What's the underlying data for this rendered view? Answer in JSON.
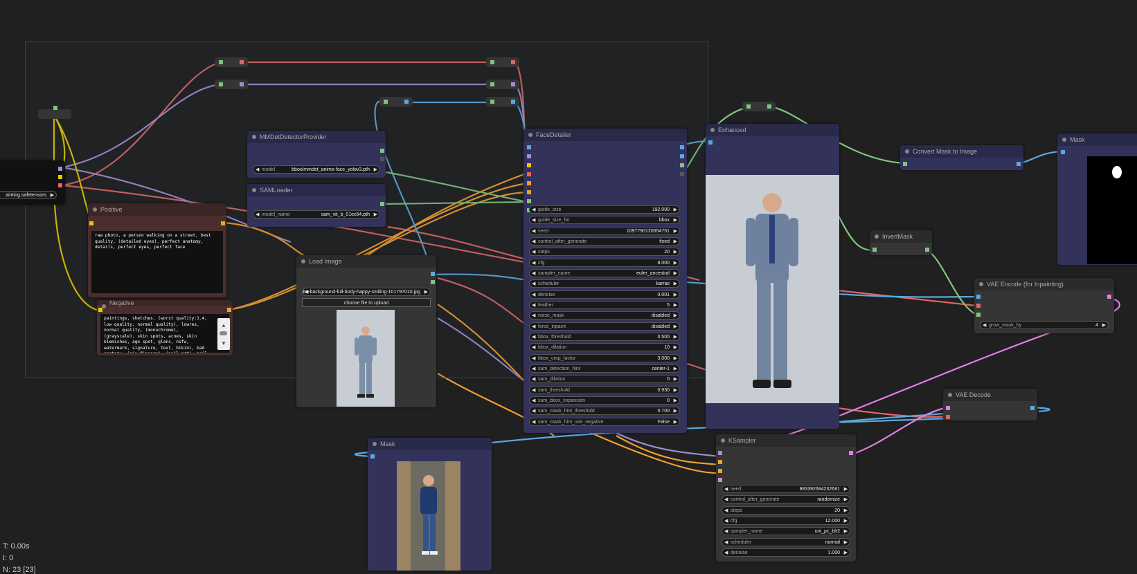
{
  "nodes": {
    "mmdet": {
      "title": "MMDetDetectorProvider",
      "model_label": "model",
      "model_value": "bbox/mmdet_anime-face_yolov3.pth"
    },
    "sam": {
      "title": "SAMLoader",
      "model_label": "model_name",
      "model_value": "sam_vit_b_01ec64.pth"
    },
    "checkpoint": {
      "value": "ainting.safetensors"
    },
    "positive": {
      "title": "Positive",
      "text": "raw photo, a person walking on a street, best quality, (detailed eyes), perfect anatomy, details, perfect eyes, perfect face"
    },
    "negative": {
      "title": "Negative",
      "text": "paintings, sketches, (worst quality:1.4, low quality, normal quality), lowres, normal quality, (monochrome), (grayscale), skin spots, acnes, skin blemishes, age spot, glans, nsfw, watermark, signature, text, bikini, bad anatomy, (six_fingers), (nail_art), nail"
    },
    "load_image": {
      "title": "Load Image",
      "image_value": "business-man-isolated-white-background-full-body-happy-smiling-101797010.jpg",
      "upload_label": "choose file to upload"
    },
    "facedetailer": {
      "title": "FaceDetailer",
      "widgets": [
        {
          "label": "guide_size",
          "value": "192.000"
        },
        {
          "label": "guide_size_for",
          "value": "bbox"
        },
        {
          "label": "seed",
          "value": "1097790120654751"
        },
        {
          "label": "control_after_generate",
          "value": "fixed"
        },
        {
          "label": "steps",
          "value": "20"
        },
        {
          "label": "cfg",
          "value": "8.000"
        },
        {
          "label": "sampler_name",
          "value": "euler_ancestral"
        },
        {
          "label": "scheduler",
          "value": "karras"
        },
        {
          "label": "denoise",
          "value": "0.001"
        },
        {
          "label": "feather",
          "value": "5"
        },
        {
          "label": "noise_mask",
          "value": "disabled"
        },
        {
          "label": "force_inpaint",
          "value": "disabled"
        },
        {
          "label": "bbox_threshold",
          "value": "0.500"
        },
        {
          "label": "bbox_dilation",
          "value": "10"
        },
        {
          "label": "bbox_crop_factor",
          "value": "3.000"
        },
        {
          "label": "sam_detection_hint",
          "value": "center-1"
        },
        {
          "label": "sam_dilation",
          "value": "0"
        },
        {
          "label": "sam_threshold",
          "value": "0.930"
        },
        {
          "label": "sam_bbox_expansion",
          "value": "0"
        },
        {
          "label": "sam_mask_hint_threshold",
          "value": "0.700"
        },
        {
          "label": "sam_mask_hint_use_negative",
          "value": "False"
        }
      ]
    },
    "enhanced": {
      "title": "Enhanced"
    },
    "convert_mask": {
      "title": "Convert Mask to Image"
    },
    "mask_right": {
      "title": "Mask"
    },
    "invert_mask": {
      "title": "InvertMask"
    },
    "vae_encode": {
      "title": "VAE Encode (for Inpainting)",
      "grow_label": "grow_mask_by",
      "grow_value": "4"
    },
    "vae_decode": {
      "title": "VAE Decode"
    },
    "mask_bottom": {
      "title": "Mask"
    },
    "ksampler": {
      "title": "KSampler",
      "widgets": [
        {
          "label": "seed",
          "value": "883392684232681"
        },
        {
          "label": "control_after_generate",
          "value": "randomize"
        },
        {
          "label": "steps",
          "value": "20"
        },
        {
          "label": "cfg",
          "value": "12.000"
        },
        {
          "label": "sampler_name",
          "value": "uni_pc_bh2"
        },
        {
          "label": "scheduler",
          "value": "normal"
        },
        {
          "label": "denoise",
          "value": "1.000"
        }
      ]
    }
  },
  "stats": {
    "time": "T: 0.00s",
    "iterations": "I: 0",
    "nodes": "N: 23 [23]"
  },
  "colors": {
    "model": "#b39ddb",
    "clip": "#ffd500",
    "vae": "#ff6e6e",
    "conditioning": "#ffa931",
    "image": "#64b5f6",
    "mask": "#81c784",
    "latent": "#ff9cf9"
  }
}
